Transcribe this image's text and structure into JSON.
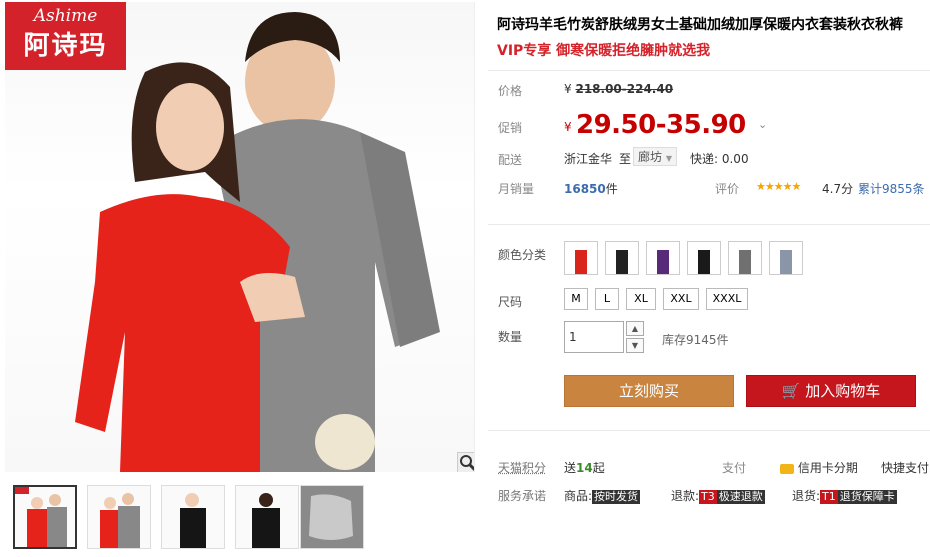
{
  "brand": {
    "logo_script": "Ashime",
    "logo_cn": "阿诗玛"
  },
  "product": {
    "title": "阿诗玛羊毛竹炭舒肤绒男女士基础加绒加厚保暖内衣套装秋衣秋裤",
    "subtitle": "VIP专享 御寒保暖拒绝臃肿就选我"
  },
  "price": {
    "label": "价格",
    "currency": "¥",
    "original": "218.00-224.40"
  },
  "promo": {
    "label": "促销",
    "currency": "¥",
    "price": "29.50-35.90"
  },
  "shipping": {
    "label": "配送",
    "from": "浙江金华",
    "to_label": "至",
    "destination": "廊坊",
    "fee": "快递: 0.00"
  },
  "sales": {
    "label": "月销量",
    "count": "16850",
    "unit": "件",
    "rating_label": "评价",
    "stars": "★★★★★",
    "score": "4.7分",
    "reviews": "累计9855条"
  },
  "colors": {
    "label": "颜色分类",
    "swatch_colors": [
      "#d9261c",
      "#222222",
      "#5a2a7a",
      "#1a1a1a",
      "#707070",
      "#8a96a8"
    ]
  },
  "sizes": {
    "label": "尺码",
    "options": [
      "M",
      "L",
      "XL",
      "XXL",
      "XXXL"
    ]
  },
  "quantity": {
    "label": "数量",
    "value": "1",
    "stock": "库存9145件"
  },
  "actions": {
    "buy_now": "立刻购买",
    "add_to_cart": "加入购物车"
  },
  "points": {
    "label": "天猫积分",
    "prefix": "送",
    "amount": "14",
    "suffix": "起"
  },
  "payment": {
    "label": "支付",
    "credit": "信用卡分期",
    "quick": "快捷支付"
  },
  "service": {
    "label": "服务承诺",
    "goods_label": "商品:",
    "goods_tag": "按时发货",
    "refund_label": "退款:",
    "refund_tag_code": "T3",
    "refund_tag": "极速退款",
    "return_label": "退货:",
    "return_tag_code": "T1",
    "return_tag": "退货保障卡"
  },
  "colors_theme": {
    "accent": "#c40000",
    "buy": "#c9853f",
    "cart": "#c4161c",
    "link": "#3c6cae"
  }
}
